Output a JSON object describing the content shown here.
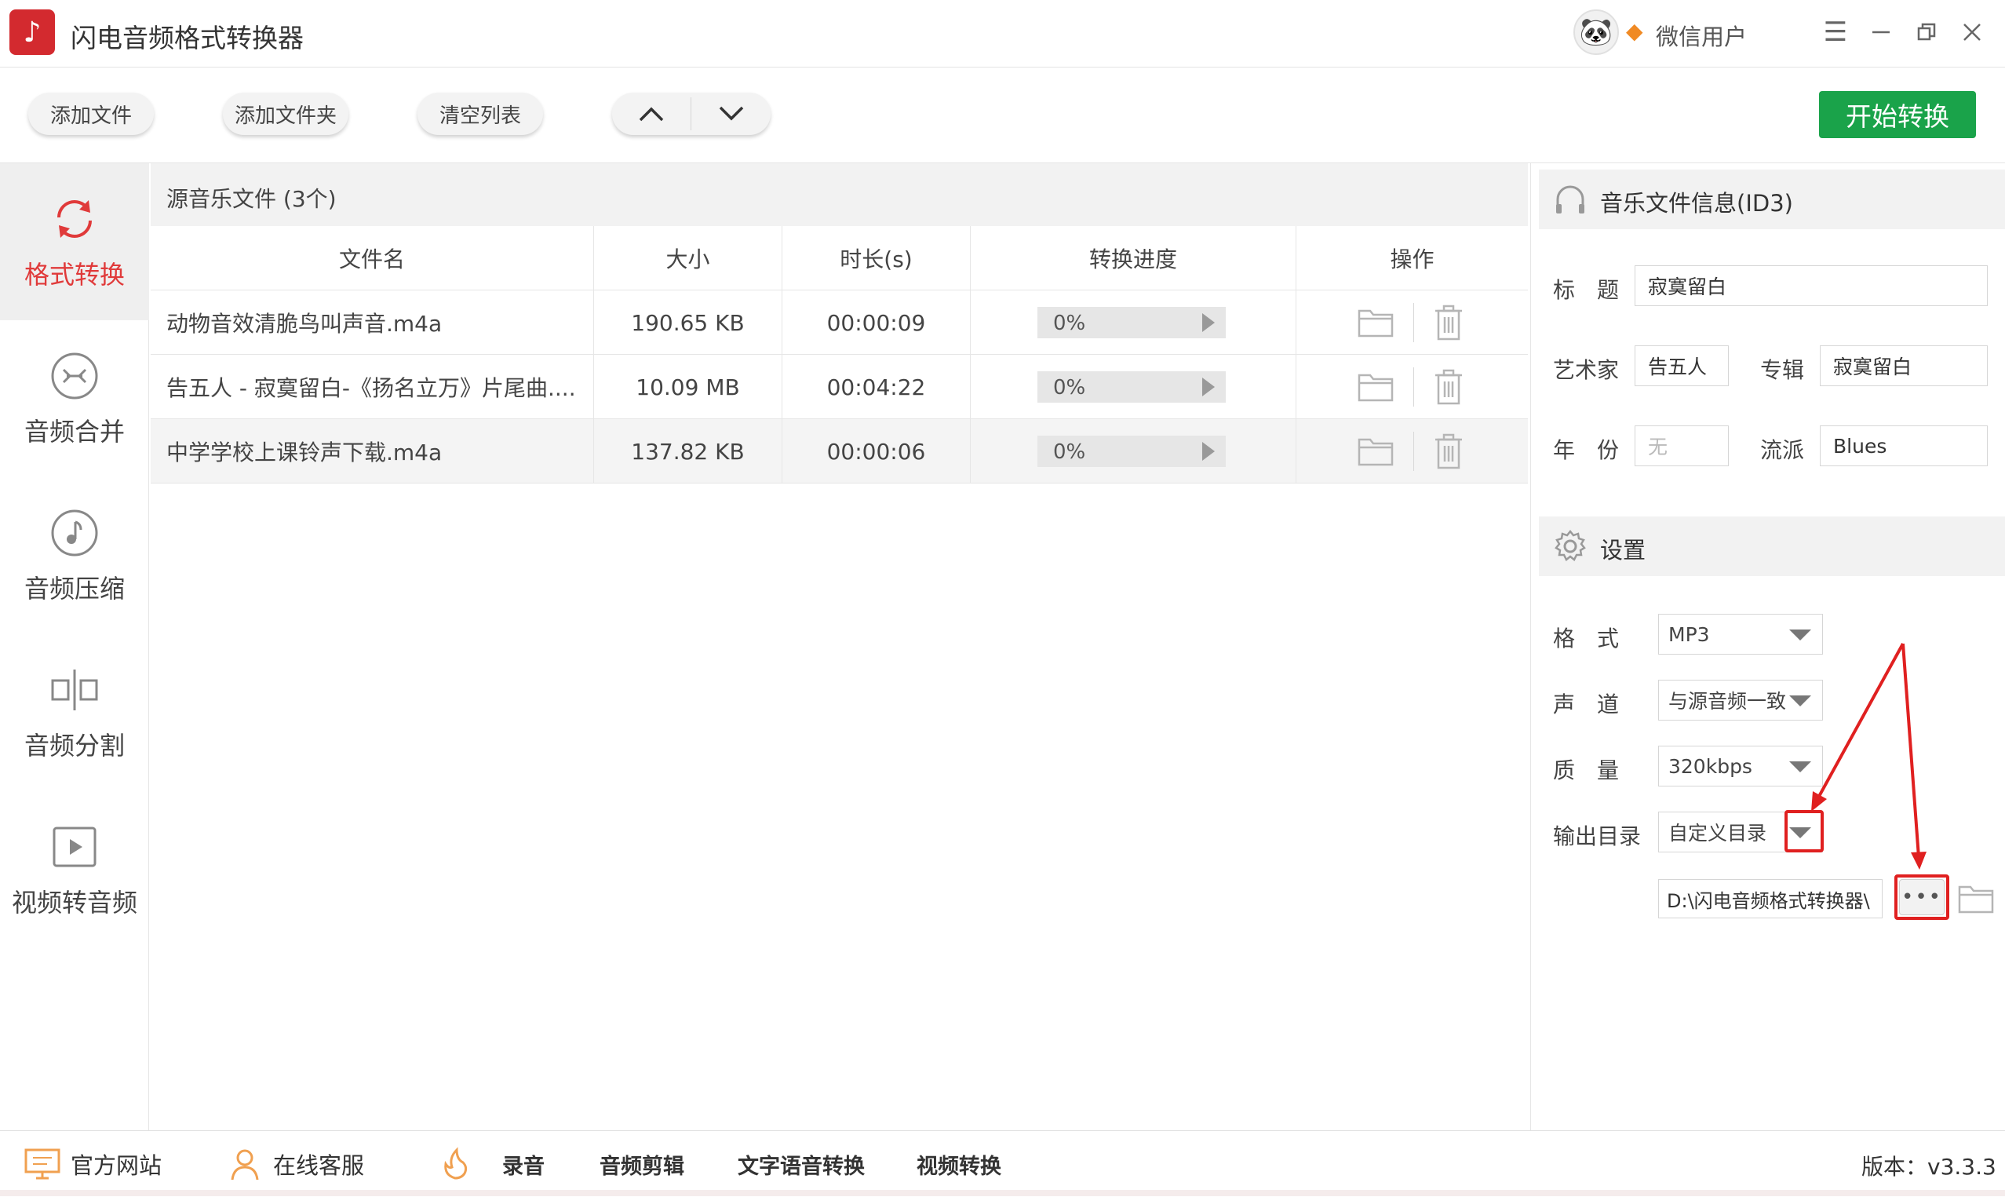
{
  "app": {
    "title": "闪电音频格式转换器",
    "user_name": "微信用户"
  },
  "toolbar": {
    "add_file": "添加文件",
    "add_folder": "添加文件夹",
    "clear_list": "清空列表",
    "move_up": "∧",
    "move_down": "∨",
    "start": "开始转换"
  },
  "sidebar": {
    "items": [
      {
        "label": "格式转换",
        "icon": "convert-icon",
        "active": true
      },
      {
        "label": "音频合并",
        "icon": "merge-icon",
        "active": false
      },
      {
        "label": "音频压缩",
        "icon": "music-note-icon",
        "active": false
      },
      {
        "label": "音频分割",
        "icon": "split-icon",
        "active": false
      },
      {
        "label": "视频转音频",
        "icon": "video-play-icon",
        "active": false
      }
    ]
  },
  "file_list": {
    "title": "源音乐文件 (3个)",
    "columns": [
      "文件名",
      "大小",
      "时长(s)",
      "转换进度",
      "操作"
    ],
    "rows": [
      {
        "name": "动物音效清脆鸟叫声音.m4a",
        "size": "190.65 KB",
        "duration": "00:00:09",
        "progress": "0%",
        "progress_value": 0
      },
      {
        "name": "告五人 - 寂寞留白-《扬名立万》片尾曲....",
        "size": "10.09 MB",
        "duration": "00:04:22",
        "progress": "0%",
        "progress_value": 0
      },
      {
        "name": "中学学校上课铃声下载.m4a",
        "size": "137.82 KB",
        "duration": "00:00:06",
        "progress": "0%",
        "progress_value": 0
      }
    ]
  },
  "id3": {
    "title": "音乐文件信息(ID3)",
    "title_label": "标　题",
    "title_value": "寂寞留白",
    "artist_label": "艺术家",
    "artist_value": "告五人",
    "album_label": "专辑",
    "album_value": "寂寞留白",
    "year_label": "年　份",
    "year_placeholder": "无",
    "genre_label": "流派",
    "genre_value": "Blues"
  },
  "settings": {
    "title": "设置",
    "format_label": "格　式",
    "format_value": "MP3",
    "channel_label": "声　道",
    "channel_value": "与源音频一致",
    "quality_label": "质　量",
    "quality_value": "320kbps",
    "output_label": "输出目录",
    "output_value": "自定义目录",
    "output_path": "D:\\闪电音频格式转换器\\",
    "browse": "•••"
  },
  "bottom": {
    "website": "官方网站",
    "service": "在线客服",
    "record": "录音",
    "audio_edit": "音频剪辑",
    "tts": "文字语音转换",
    "video_convert": "视频转换",
    "version": "版本：v3.3.3"
  },
  "colors": {
    "accent_red": "#e03a3a",
    "start_green": "#1aa34a",
    "annotation_red": "#e02020"
  }
}
